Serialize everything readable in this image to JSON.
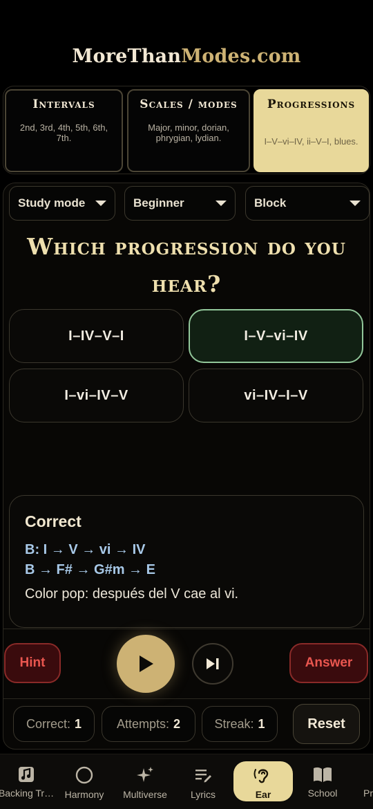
{
  "logo": {
    "part1": "MoreThan",
    "part2": "Modes",
    "part3": ".com"
  },
  "categories": [
    {
      "title": "Intervals",
      "desc": "2nd, 3rd, 4th, 5th, 6th, 7th."
    },
    {
      "title": "Scales / modes",
      "desc": "Major, minor, dorian, phrygian, lydian."
    },
    {
      "title": "Progressions",
      "desc": "I–V–vi–IV, ii–V–I, blues."
    }
  ],
  "controls": {
    "mode": "Study mode",
    "level": "Beginner",
    "voicing": "Block"
  },
  "question": "Which progression do you hear?",
  "answers": [
    "I–IV–V–I",
    "I–V–vi–IV",
    "I–vi–IV–V",
    "vi–IV–I–V"
  ],
  "feedback": {
    "title": "Correct",
    "roman": "B: I → V → vi → IV",
    "chords": "B → F# → G#m → E",
    "note": "Color pop: después del V cae al vi."
  },
  "actions": {
    "hint": "Hint",
    "answer": "Answer",
    "reset": "Reset"
  },
  "stats": {
    "correct_label": "Correct:",
    "correct": "1",
    "attempts_label": "Attempts:",
    "attempts": "2",
    "streak_label": "Streak:",
    "streak": "1"
  },
  "nav": [
    "Backing Tr…",
    "Harmony",
    "Multiverse",
    "Lyrics",
    "Ear",
    "School",
    "Pr"
  ],
  "colors": {
    "accent": "#cdb274",
    "selected_tab": "#e8d89a",
    "correct_border": "#92c79a",
    "danger": "#e9564f"
  }
}
